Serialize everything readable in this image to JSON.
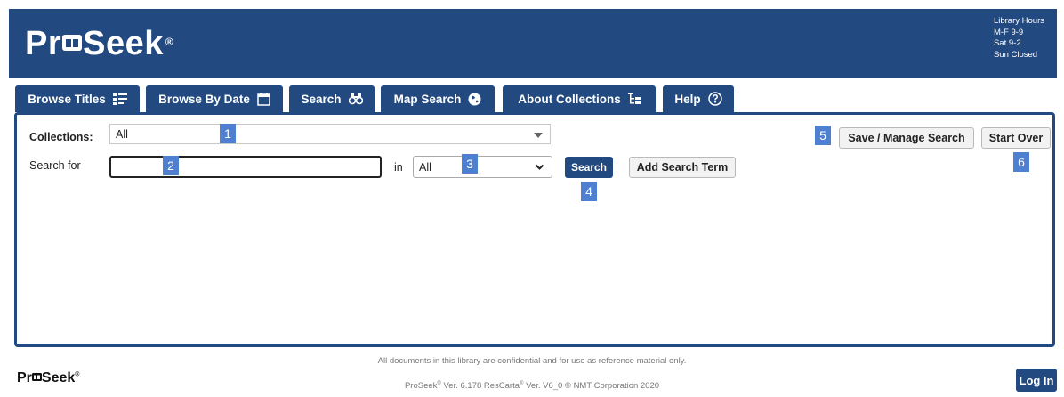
{
  "header": {
    "logo_text": "PrSeek",
    "logo_reg": "®",
    "hours": [
      "Library Hours",
      "M-F 9-9",
      "Sat 9-2",
      "Sun Closed"
    ]
  },
  "tabs": [
    {
      "label": "Browse Titles",
      "icon": "list-icon"
    },
    {
      "label": "Browse By Date",
      "icon": "calendar-icon"
    },
    {
      "label": "Search",
      "icon": "binoculars-icon"
    },
    {
      "label": "Map Search",
      "icon": "globe-icon"
    },
    {
      "label": "About Collections",
      "icon": "tree-icon"
    },
    {
      "label": "Help",
      "icon": "help-icon"
    }
  ],
  "form": {
    "collections_label": "Collections:",
    "collections_value": "All",
    "search_for_label": "Search for",
    "search_value": "",
    "in_label": "in",
    "in_value": "All",
    "search_button": "Search",
    "add_term_button": "Add Search Term",
    "save_button": "Save / Manage Search",
    "start_over_button": "Start Over"
  },
  "badges": [
    "1",
    "2",
    "3",
    "4",
    "5",
    "6"
  ],
  "footer": {
    "note": "All documents in this library are confidential and for use as reference material only.",
    "logo": "PrSeek",
    "version_prefix": "ProSeek",
    "version_mid": " Ver. 6.178 ResCarta",
    "version_suffix": " Ver. V6_0 © NMT Corporation 2020",
    "reg": "®",
    "login_button": "Log In"
  },
  "colors": {
    "brand": "#234a80",
    "badge": "#4f7fd0"
  }
}
